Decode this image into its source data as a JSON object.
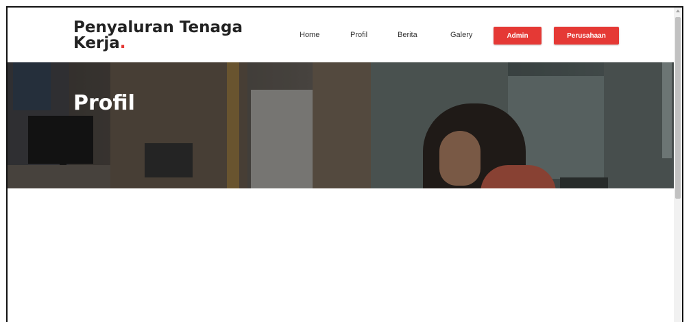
{
  "header": {
    "brand_line1": "Penyaluran Tenaga",
    "brand_line2": "Kerja",
    "brand_dot": ".",
    "nav": [
      {
        "label": "Home"
      },
      {
        "label": "Profil"
      },
      {
        "label": "Berita"
      },
      {
        "label": "Galery"
      }
    ],
    "buttons": {
      "admin": "Admin",
      "perusahaan": "Perusahaan"
    }
  },
  "hero": {
    "title": "Profil"
  },
  "colors": {
    "accent": "#e53935",
    "text": "#222222"
  }
}
